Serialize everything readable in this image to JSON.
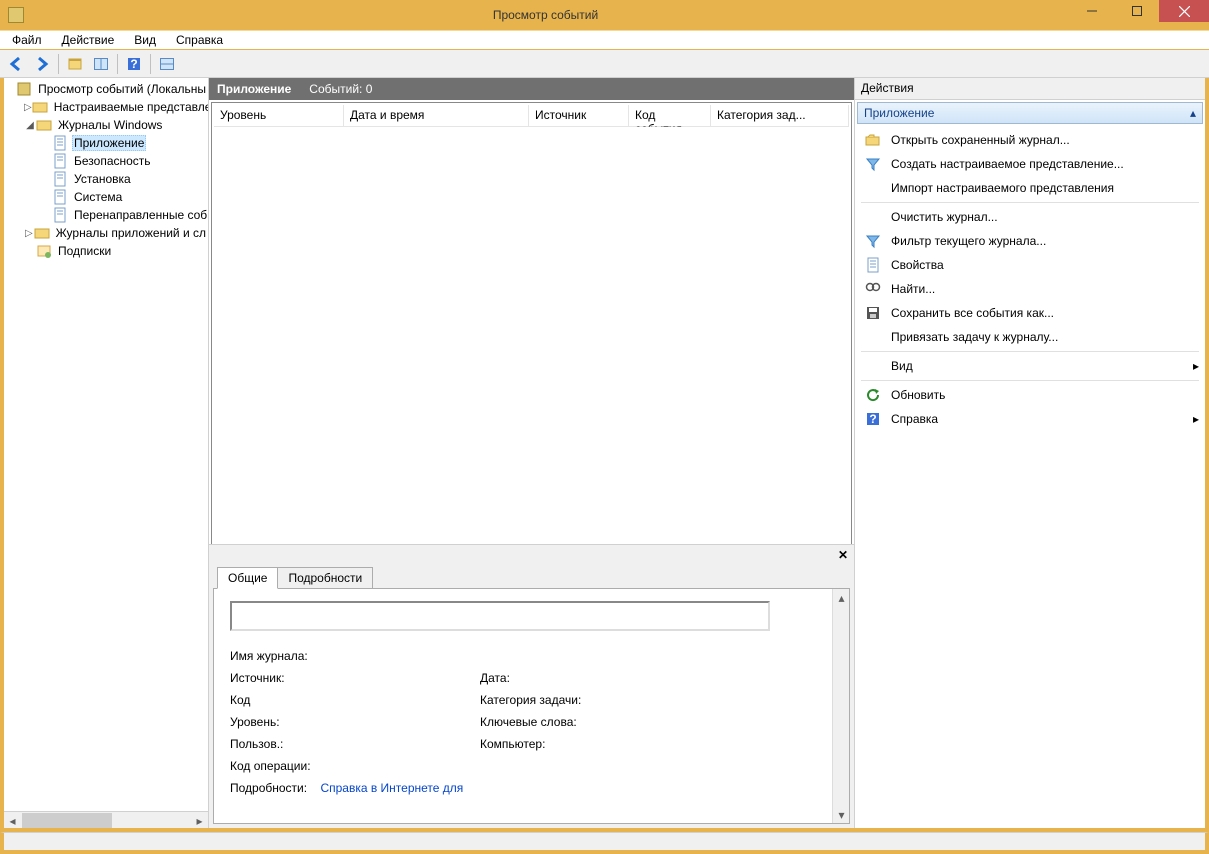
{
  "window": {
    "title": "Просмотр событий"
  },
  "menu": {
    "file": "Файл",
    "action": "Действие",
    "view": "Вид",
    "help": "Справка"
  },
  "tree": {
    "root": "Просмотр событий (Локальны",
    "custom_views": "Настраиваемые представле",
    "windows_logs": "Журналы Windows",
    "application": "Приложение",
    "security": "Безопасность",
    "setup": "Установка",
    "system": "Система",
    "forwarded": "Перенаправленные соб",
    "app_service_logs": "Журналы приложений и сл",
    "subscriptions": "Подписки"
  },
  "center": {
    "header_title": "Приложение",
    "header_count": "Событий: 0",
    "columns": {
      "level": "Уровень",
      "datetime": "Дата и время",
      "source": "Источник",
      "event_id": "Код события",
      "category": "Категория зад..."
    }
  },
  "detail": {
    "tab_general": "Общие",
    "tab_details": "Подробности",
    "log_name": "Имя журнала:",
    "source": "Источник:",
    "date": "Дата:",
    "code": "Код",
    "category": "Категория задачи:",
    "level": "Уровень:",
    "keywords": "Ключевые слова:",
    "user": "Пользов.:",
    "computer": "Компьютер:",
    "opcode": "Код операции:",
    "more_info": "Подробности:",
    "help_link": "Справка в Интернете для"
  },
  "actions": {
    "pane_title": "Действия",
    "section": "Приложение",
    "open_saved": "Открыть сохраненный журнал...",
    "create_view": "Создать настраиваемое представление...",
    "import_view": "Импорт настраиваемого представления",
    "clear_log": "Очистить журнал...",
    "filter_log": "Фильтр текущего журнала...",
    "properties": "Свойства",
    "find": "Найти...",
    "save_all": "Сохранить все события как...",
    "attach_task": "Привязать задачу к журналу...",
    "view": "Вид",
    "refresh": "Обновить",
    "help": "Справка"
  }
}
